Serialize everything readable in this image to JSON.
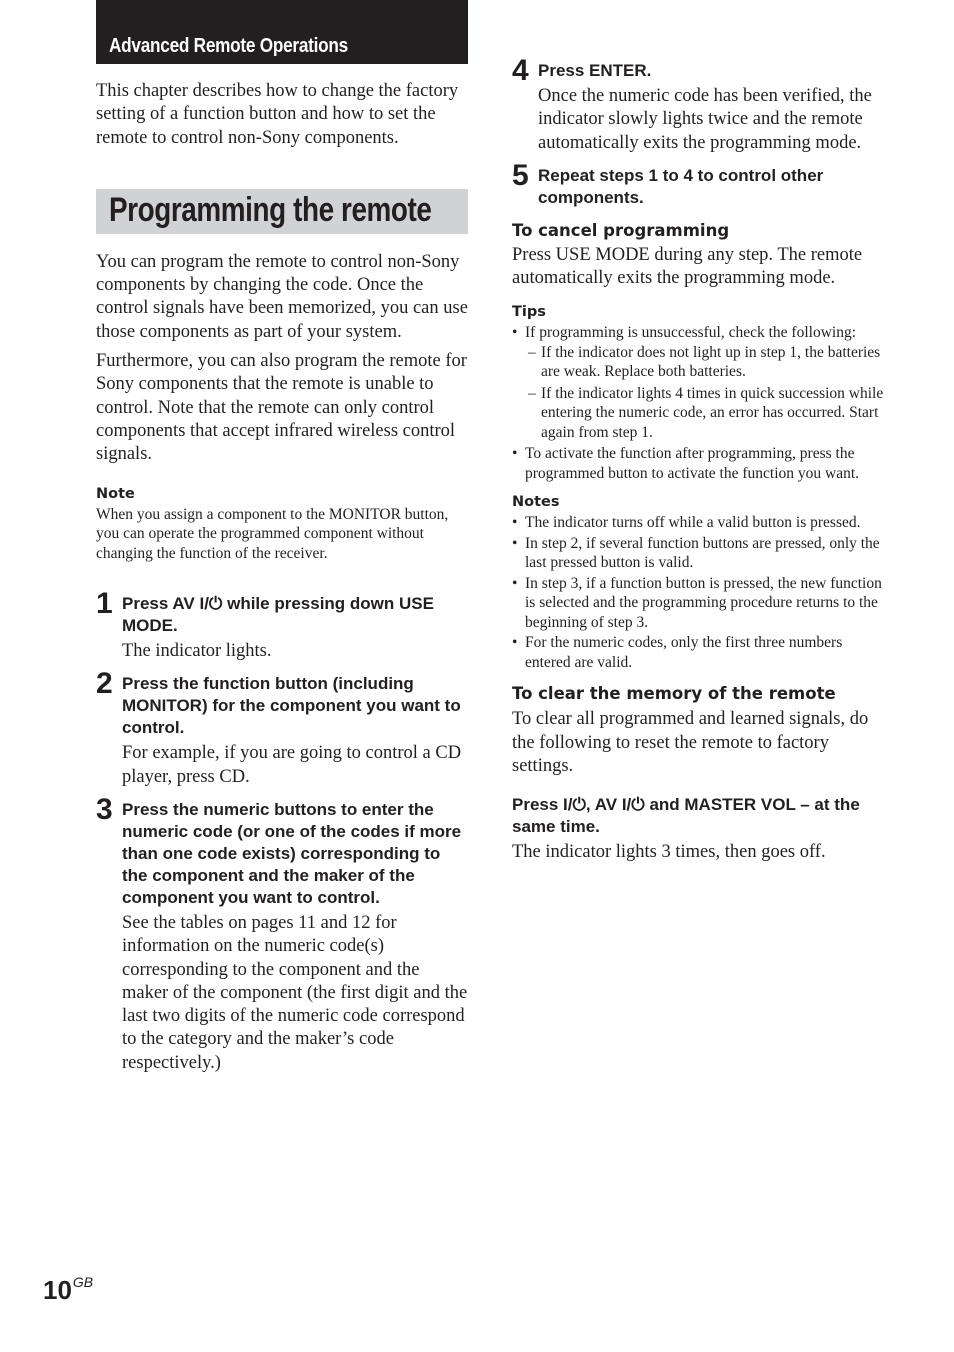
{
  "chapter_title": "Advanced Remote Operations",
  "intro": "This chapter describes how to change the factory setting of a function button and how to set the remote to control non-Sony components.",
  "section_title": "Programming the remote",
  "paragraphs": [
    "You can program the remote to control non-Sony components by changing the code. Once the control signals have been memorized, you can use those components as part of your system.",
    "Furthermore, you can also program the remote for Sony components that the remote is unable to control. Note that the remote can only control components that accept infrared wireless control signals."
  ],
  "note": {
    "heading": "Note",
    "text": "When you assign a component to the MONITOR button, you can operate the programmed component without changing the function of the receiver."
  },
  "steps": [
    {
      "num": "1",
      "head": "Press AV I/⏻ while pressing down USE MODE.",
      "body": "The indicator lights."
    },
    {
      "num": "2",
      "head": "Press the function button (including MONITOR) for the component you want to control.",
      "body": "For example, if you are going to control a CD player, press CD."
    },
    {
      "num": "3",
      "head": "Press the numeric buttons to enter the numeric code (or one of the codes if more than one code exists) corresponding to the component and the maker of the component you want to control.",
      "body": "See the tables on pages 11 and 12 for information on the numeric code(s) corresponding to the component and the maker of the component (the first digit and the last two digits of the numeric code correspond to the category and the maker’s code respectively.)"
    },
    {
      "num": "4",
      "head": "Press ENTER.",
      "body": "Once the numeric code has been verified, the indicator slowly lights twice and the remote automatically exits the programming mode."
    },
    {
      "num": "5",
      "head": "Repeat steps 1 to 4 to control other components.",
      "body": ""
    }
  ],
  "cancel": {
    "heading": "To cancel programming",
    "text": "Press USE MODE during any step. The remote automatically exits the programming mode."
  },
  "tips": {
    "heading": "Tips",
    "items": [
      {
        "text": "If programming is unsuccessful, check the following:",
        "subitems": [
          "If the indicator does not light up in step 1, the batteries are weak. Replace both batteries.",
          "If the indicator lights 4 times in quick succession while entering the numeric code, an error has occurred. Start again from step 1."
        ]
      },
      {
        "text": "To activate the function after programming, press the programmed button to activate the function you want.",
        "subitems": []
      }
    ]
  },
  "notes": {
    "heading": "Notes",
    "items": [
      "The indicator turns off while a valid button is pressed.",
      "In step 2, if several function buttons are pressed, only the last pressed button is valid.",
      "In step 3, if a function button is pressed, the new function is selected and the programming procedure returns to the beginning of step 3.",
      "For the numeric codes, only the first three numbers entered are valid."
    ]
  },
  "clear": {
    "heading": "To clear the memory of the remote",
    "text": "To clear all programmed and learned signals, do the following to reset the remote to factory settings.",
    "instruction": "Press I/⏻, AV I/⏻ and MASTER VOL –  at the same time.",
    "result": "The indicator lights 3 times, then goes off."
  },
  "page": {
    "number": "10",
    "suffix": "GB"
  }
}
